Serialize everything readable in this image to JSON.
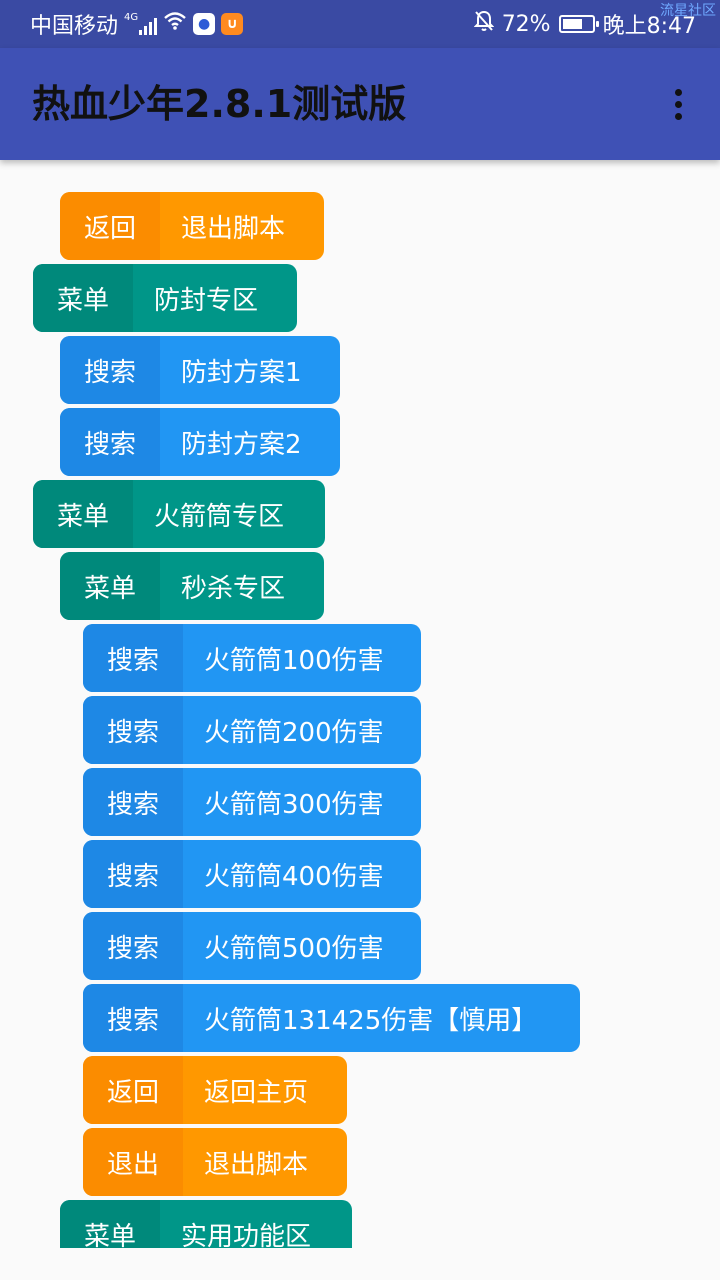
{
  "status_bar": {
    "carrier": "中国移动",
    "network": "4G",
    "battery": "72%",
    "battery_level": 0.72,
    "time": "晚上8:47",
    "watermark": "流星社区",
    "icons": [
      "signal-icon",
      "wifi-icon",
      "baidu-app-icon",
      "uc-app-icon",
      "mute-bell-icon",
      "battery-icon"
    ]
  },
  "toolbar": {
    "title": "热血少年2.8.1测试版"
  },
  "colors": {
    "toolbar": "#3f51b5",
    "status_bar": "#3a4aa3",
    "orange": "#ff9800",
    "teal": "#009688",
    "blue": "#2196f3"
  },
  "items": [
    {
      "tag": "返回",
      "label": "退出脚本"
    },
    {
      "tag": "菜单",
      "label": "防封专区"
    },
    {
      "tag": "搜索",
      "label": "防封方案1"
    },
    {
      "tag": "搜索",
      "label": "防封方案2"
    },
    {
      "tag": "菜单",
      "label": "火箭筒专区"
    },
    {
      "tag": "菜单",
      "label": "秒杀专区"
    },
    {
      "tag": "搜索",
      "label": "火箭筒100伤害"
    },
    {
      "tag": "搜索",
      "label": "火箭筒200伤害"
    },
    {
      "tag": "搜索",
      "label": "火箭筒300伤害"
    },
    {
      "tag": "搜索",
      "label": "火箭筒400伤害"
    },
    {
      "tag": "搜索",
      "label": "火箭筒500伤害"
    },
    {
      "tag": "搜索",
      "label": "火箭筒131425伤害【慎用】"
    },
    {
      "tag": "返回",
      "label": "返回主页"
    },
    {
      "tag": "退出",
      "label": "退出脚本"
    },
    {
      "tag": "菜单",
      "label": "实用功能区"
    }
  ]
}
